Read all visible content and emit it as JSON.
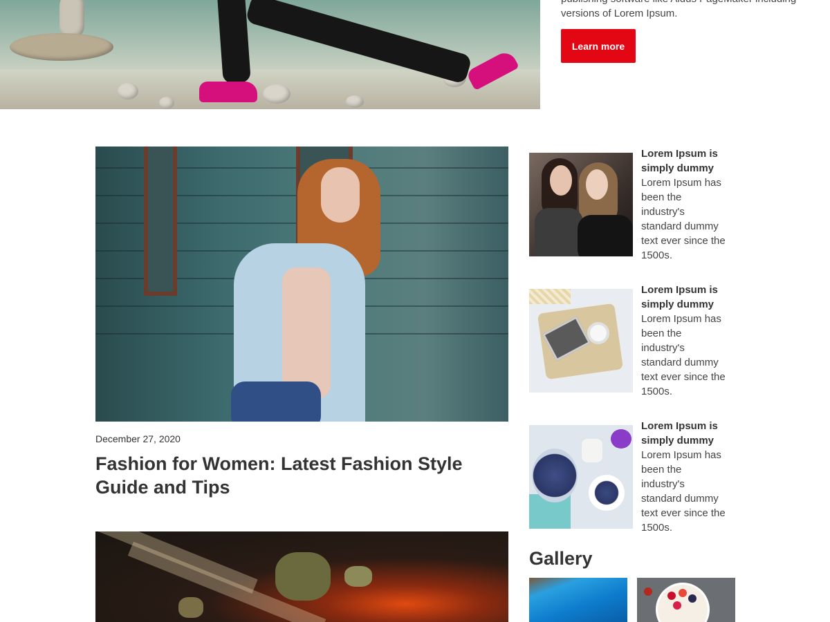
{
  "hero": {
    "text": "publishing software like Aldus PageMaker including versions of Lorem Ipsum.",
    "button_label": "Learn more",
    "button_color": "#e30613"
  },
  "main_article": {
    "date": "December 27, 2020",
    "title": "Fashion for Women: Latest Fashion Style Guide and Tips"
  },
  "sidebar": {
    "items": [
      {
        "title": "Lorem Ipsum is simply dummy",
        "body": " Lorem Ipsum has been the industry's standard dummy text ever since the 1500s."
      },
      {
        "title": "Lorem Ipsum is simply dummy",
        "body": " Lorem Ipsum has been the industry's standard dummy text ever since the 1500s."
      },
      {
        "title": "Lorem Ipsum is simply dummy",
        "body": " Lorem Ipsum has been the industry's standard dummy text ever since the 1500s."
      }
    ],
    "gallery_title": "Gallery"
  }
}
